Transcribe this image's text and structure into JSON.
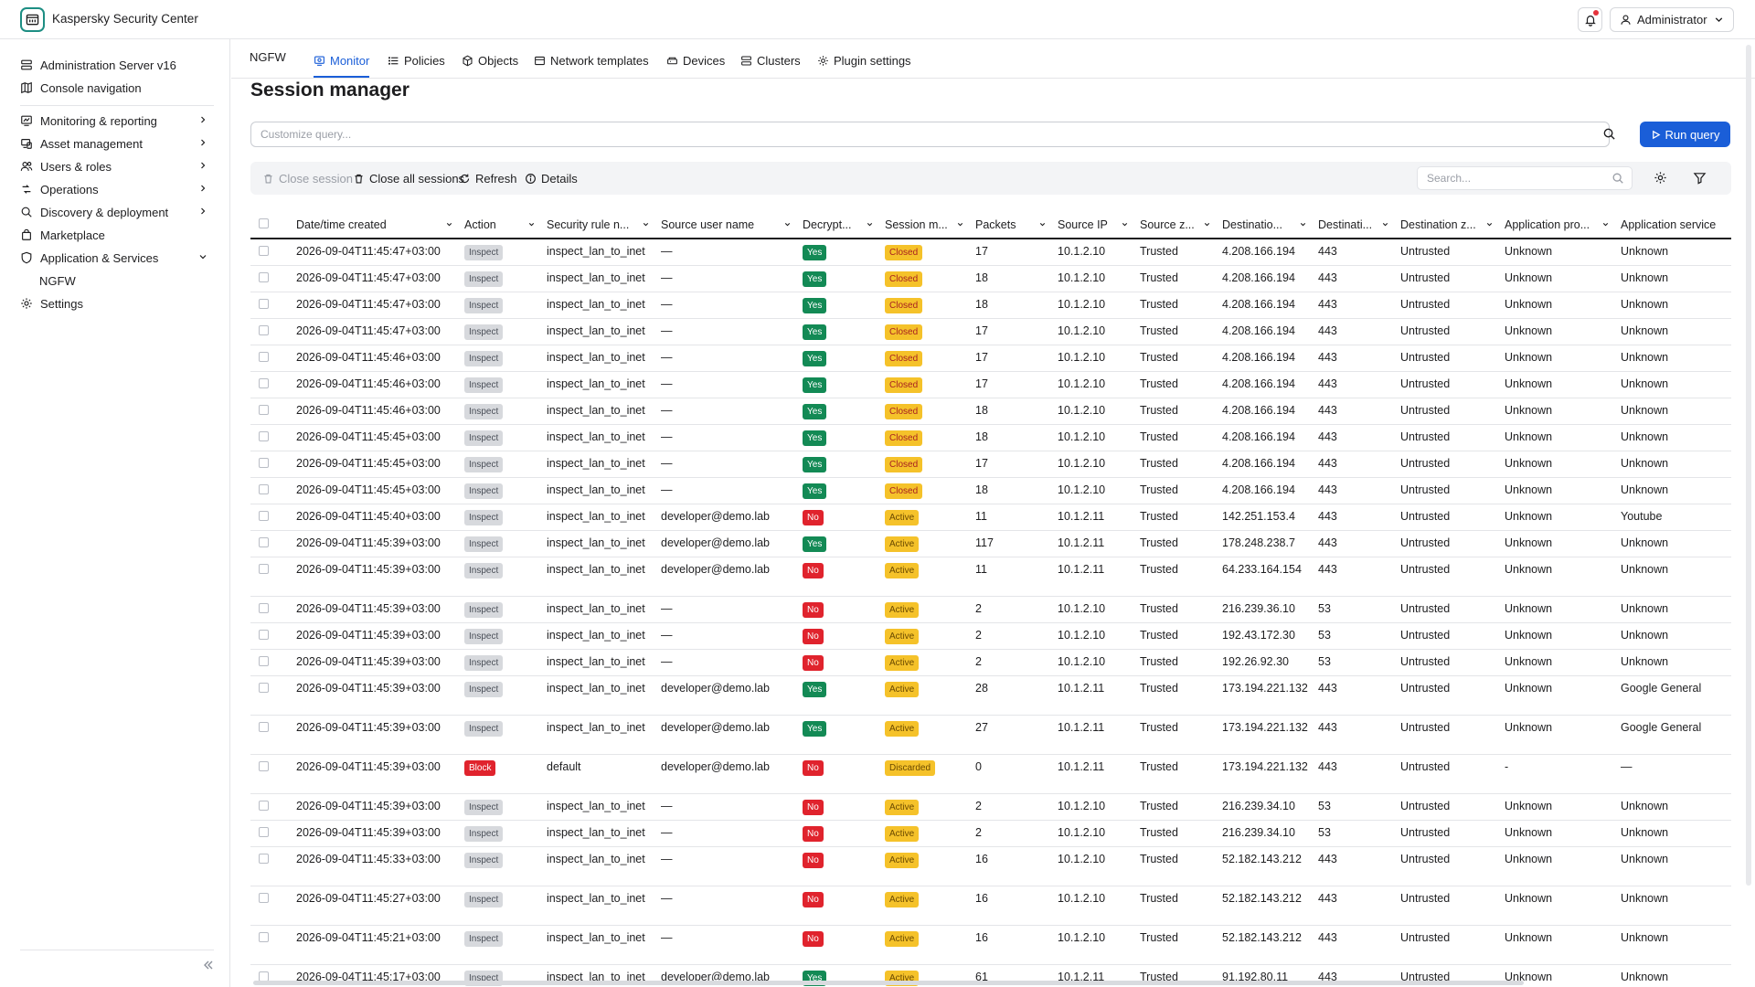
{
  "app": {
    "title": "Kaspersky Security Center"
  },
  "header": {
    "user_label": "Administrator"
  },
  "sidebar": {
    "items": [
      {
        "label": "Administration Server v16",
        "icon": "server-icon"
      },
      {
        "label": "Console navigation",
        "icon": "map-icon"
      },
      {
        "label": "Monitoring & reporting",
        "icon": "monitor-icon"
      },
      {
        "label": "Asset management",
        "icon": "devices-icon"
      },
      {
        "label": "Users & roles",
        "icon": "users-icon"
      },
      {
        "label": "Operations",
        "icon": "operations-icon"
      },
      {
        "label": "Discovery & deployment",
        "icon": "discovery-icon"
      },
      {
        "label": "Marketplace",
        "icon": "bag-icon"
      },
      {
        "label": "Application & Services",
        "icon": "shield-icon"
      },
      {
        "label": "NGFW"
      },
      {
        "label": "Settings",
        "icon": "gear-icon"
      }
    ]
  },
  "tabs": {
    "root": "NGFW",
    "items": [
      {
        "label": "Monitor",
        "active": true
      },
      {
        "label": "Policies"
      },
      {
        "label": "Objects"
      },
      {
        "label": "Network templates"
      },
      {
        "label": "Devices"
      },
      {
        "label": "Clusters"
      },
      {
        "label": "Plugin settings"
      }
    ]
  },
  "page": {
    "title": "Session manager",
    "query_placeholder": "Customize query...",
    "run_query": "Run query"
  },
  "toolbar": {
    "close_session": "Close session",
    "close_all": "Close all sessions",
    "refresh": "Refresh",
    "details": "Details",
    "search_placeholder": "Search..."
  },
  "table": {
    "columns": [
      "Date/time created",
      "Action",
      "Security rule n...",
      "Source user name",
      "Decrypt...",
      "Session m...",
      "Packets",
      "Source IP",
      "Source z...",
      "Destinatio...",
      "Destinati...",
      "Destination z...",
      "Application pro...",
      "Application service"
    ],
    "rows": [
      [
        "2026-09-04T11:45:47+03:00",
        "Inspect",
        "inspect_lan_to_inet",
        "—",
        "Yes",
        "Closed",
        "17",
        "10.1.2.10",
        "Trusted",
        "4.208.166.194",
        "443",
        "Untrusted",
        "Unknown",
        "Unknown"
      ],
      [
        "2026-09-04T11:45:47+03:00",
        "Inspect",
        "inspect_lan_to_inet",
        "—",
        "Yes",
        "Closed",
        "18",
        "10.1.2.10",
        "Trusted",
        "4.208.166.194",
        "443",
        "Untrusted",
        "Unknown",
        "Unknown"
      ],
      [
        "2026-09-04T11:45:47+03:00",
        "Inspect",
        "inspect_lan_to_inet",
        "—",
        "Yes",
        "Closed",
        "18",
        "10.1.2.10",
        "Trusted",
        "4.208.166.194",
        "443",
        "Untrusted",
        "Unknown",
        "Unknown"
      ],
      [
        "2026-09-04T11:45:47+03:00",
        "Inspect",
        "inspect_lan_to_inet",
        "—",
        "Yes",
        "Closed",
        "17",
        "10.1.2.10",
        "Trusted",
        "4.208.166.194",
        "443",
        "Untrusted",
        "Unknown",
        "Unknown"
      ],
      [
        "2026-09-04T11:45:46+03:00",
        "Inspect",
        "inspect_lan_to_inet",
        "—",
        "Yes",
        "Closed",
        "17",
        "10.1.2.10",
        "Trusted",
        "4.208.166.194",
        "443",
        "Untrusted",
        "Unknown",
        "Unknown"
      ],
      [
        "2026-09-04T11:45:46+03:00",
        "Inspect",
        "inspect_lan_to_inet",
        "—",
        "Yes",
        "Closed",
        "17",
        "10.1.2.10",
        "Trusted",
        "4.208.166.194",
        "443",
        "Untrusted",
        "Unknown",
        "Unknown"
      ],
      [
        "2026-09-04T11:45:46+03:00",
        "Inspect",
        "inspect_lan_to_inet",
        "—",
        "Yes",
        "Closed",
        "18",
        "10.1.2.10",
        "Trusted",
        "4.208.166.194",
        "443",
        "Untrusted",
        "Unknown",
        "Unknown"
      ],
      [
        "2026-09-04T11:45:45+03:00",
        "Inspect",
        "inspect_lan_to_inet",
        "—",
        "Yes",
        "Closed",
        "18",
        "10.1.2.10",
        "Trusted",
        "4.208.166.194",
        "443",
        "Untrusted",
        "Unknown",
        "Unknown"
      ],
      [
        "2026-09-04T11:45:45+03:00",
        "Inspect",
        "inspect_lan_to_inet",
        "—",
        "Yes",
        "Closed",
        "17",
        "10.1.2.10",
        "Trusted",
        "4.208.166.194",
        "443",
        "Untrusted",
        "Unknown",
        "Unknown"
      ],
      [
        "2026-09-04T11:45:45+03:00",
        "Inspect",
        "inspect_lan_to_inet",
        "—",
        "Yes",
        "Closed",
        "18",
        "10.1.2.10",
        "Trusted",
        "4.208.166.194",
        "443",
        "Untrusted",
        "Unknown",
        "Unknown"
      ],
      [
        "2026-09-04T11:45:40+03:00",
        "Inspect",
        "inspect_lan_to_inet",
        "developer@demo.lab",
        "No",
        "Active",
        "11",
        "10.1.2.11",
        "Trusted",
        "142.251.153.4",
        "443",
        "Untrusted",
        "Unknown",
        "Youtube"
      ],
      [
        "2026-09-04T11:45:39+03:00",
        "Inspect",
        "inspect_lan_to_inet",
        "developer@demo.lab",
        "Yes",
        "Active",
        "117",
        "10.1.2.11",
        "Trusted",
        "178.248.238.7",
        "443",
        "Untrusted",
        "Unknown",
        "Unknown"
      ],
      [
        "2026-09-04T11:45:39+03:00",
        "Inspect",
        "inspect_lan_to_inet",
        "developer@demo.lab",
        "No",
        "Active",
        "11",
        "10.1.2.11",
        "Trusted",
        "64.233.164.154",
        "443",
        "Untrusted",
        "Unknown",
        "Unknown"
      ],
      [
        "2026-09-04T11:45:39+03:00",
        "Inspect",
        "inspect_lan_to_inet",
        "—",
        "No",
        "Active",
        "2",
        "10.1.2.10",
        "Trusted",
        "216.239.36.10",
        "53",
        "Untrusted",
        "Unknown",
        "Unknown"
      ],
      [
        "2026-09-04T11:45:39+03:00",
        "Inspect",
        "inspect_lan_to_inet",
        "—",
        "No",
        "Active",
        "2",
        "10.1.2.10",
        "Trusted",
        "192.43.172.30",
        "53",
        "Untrusted",
        "Unknown",
        "Unknown"
      ],
      [
        "2026-09-04T11:45:39+03:00",
        "Inspect",
        "inspect_lan_to_inet",
        "—",
        "No",
        "Active",
        "2",
        "10.1.2.10",
        "Trusted",
        "192.26.92.30",
        "53",
        "Untrusted",
        "Unknown",
        "Unknown"
      ],
      [
        "2026-09-04T11:45:39+03:00",
        "Inspect",
        "inspect_lan_to_inet",
        "developer@demo.lab",
        "Yes",
        "Active",
        "28",
        "10.1.2.11",
        "Trusted",
        "173.194.221.132",
        "443",
        "Untrusted",
        "Unknown",
        "Google General"
      ],
      [
        "2026-09-04T11:45:39+03:00",
        "Inspect",
        "inspect_lan_to_inet",
        "developer@demo.lab",
        "Yes",
        "Active",
        "27",
        "10.1.2.11",
        "Trusted",
        "173.194.221.132",
        "443",
        "Untrusted",
        "Unknown",
        "Google General"
      ],
      [
        "2026-09-04T11:45:39+03:00",
        "Block",
        "default",
        "developer@demo.lab",
        "No",
        "Discarded",
        "0",
        "10.1.2.11",
        "Trusted",
        "173.194.221.132",
        "443",
        "Untrusted",
        "-",
        "—"
      ],
      [
        "2026-09-04T11:45:39+03:00",
        "Inspect",
        "inspect_lan_to_inet",
        "—",
        "No",
        "Active",
        "2",
        "10.1.2.10",
        "Trusted",
        "216.239.34.10",
        "53",
        "Untrusted",
        "Unknown",
        "Unknown"
      ],
      [
        "2026-09-04T11:45:39+03:00",
        "Inspect",
        "inspect_lan_to_inet",
        "—",
        "No",
        "Active",
        "2",
        "10.1.2.10",
        "Trusted",
        "216.239.34.10",
        "53",
        "Untrusted",
        "Unknown",
        "Unknown"
      ],
      [
        "2026-09-04T11:45:33+03:00",
        "Inspect",
        "inspect_lan_to_inet",
        "—",
        "No",
        "Active",
        "16",
        "10.1.2.10",
        "Trusted",
        "52.182.143.212",
        "443",
        "Untrusted",
        "Unknown",
        "Unknown"
      ],
      [
        "2026-09-04T11:45:27+03:00",
        "Inspect",
        "inspect_lan_to_inet",
        "—",
        "No",
        "Active",
        "16",
        "10.1.2.10",
        "Trusted",
        "52.182.143.212",
        "443",
        "Untrusted",
        "Unknown",
        "Unknown"
      ],
      [
        "2026-09-04T11:45:21+03:00",
        "Inspect",
        "inspect_lan_to_inet",
        "—",
        "No",
        "Active",
        "16",
        "10.1.2.10",
        "Trusted",
        "52.182.143.212",
        "443",
        "Untrusted",
        "Unknown",
        "Unknown"
      ],
      [
        "2026-09-04T11:45:17+03:00",
        "Inspect",
        "inspect_lan_to_inet",
        "developer@demo.lab",
        "Yes",
        "Active",
        "61",
        "10.1.2.11",
        "Trusted",
        "91.192.80.11",
        "443",
        "Untrusted",
        "Unknown",
        "Unknown"
      ]
    ]
  },
  "colors": {
    "accent": "#1a5ed8",
    "brand": "#1d8e83",
    "yes": "#138a55",
    "no": "#e0232d",
    "status": "#f5c22a"
  }
}
